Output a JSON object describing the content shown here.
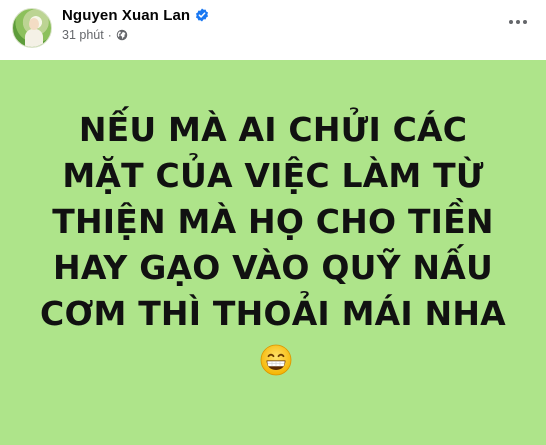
{
  "post": {
    "author": "Nguyen Xuan Lan",
    "time": "31 phút",
    "separator": "·",
    "privacy_icon": "globe-icon",
    "verified_icon": "verified-badge-icon",
    "more_icon": "more-options-icon"
  },
  "content": {
    "background_color": "#aee48a",
    "text": "NẾU MÀ AI CHỬI CÁC MẶT CỦA VIỆC LÀM TỪ THIỆN MÀ HỌ CHO TIỀN HAY GẠO VÀO QUỸ NẤU CƠM THÌ THOẢI MÁI NHA",
    "emoji": "grinning-face-icon"
  },
  "colors": {
    "verified_blue": "#1877f2",
    "meta_gray": "#65676b"
  }
}
